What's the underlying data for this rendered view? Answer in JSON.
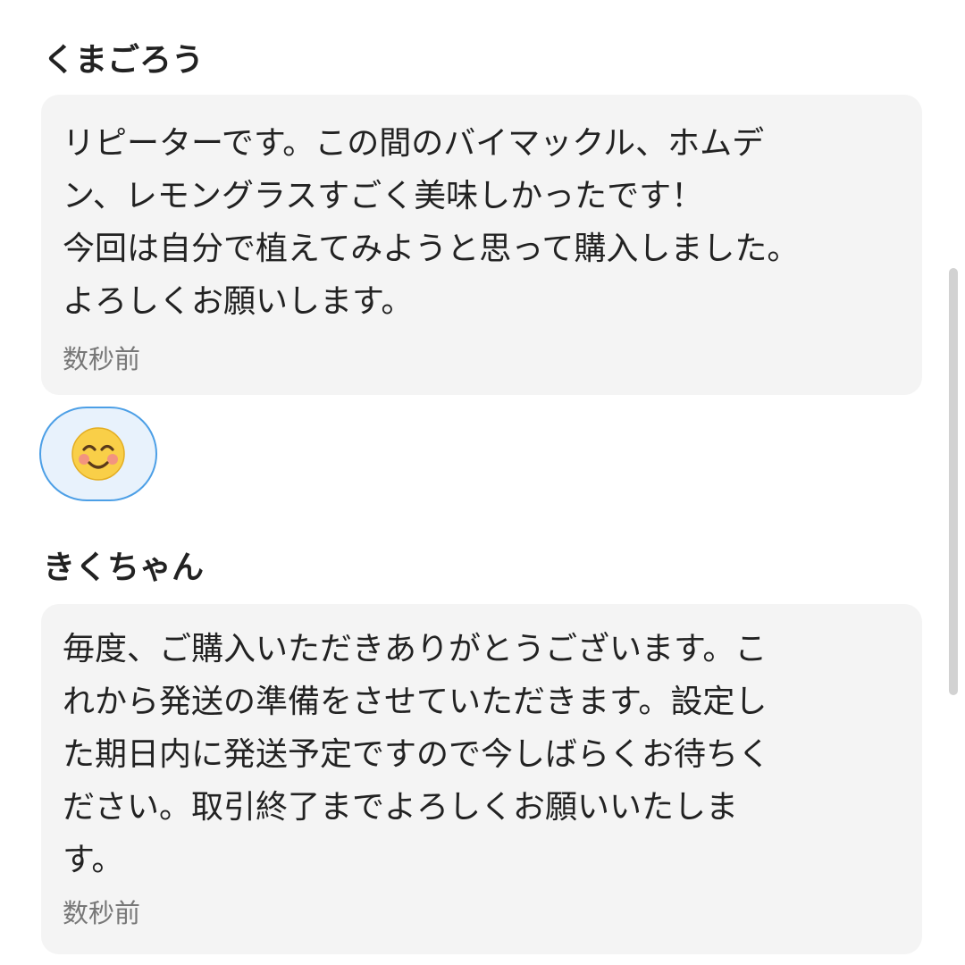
{
  "messages": [
    {
      "username": "くまごろう",
      "lines": [
        "リピーターです。この間のバイマックル、ホムデ",
        "ン、レモングラスすごく美味しかったです！",
        "今回は自分で植えてみようと思って購入しました。",
        "よろしくお願いします。"
      ],
      "timestamp": "数秒前",
      "reaction": {
        "icon": "smiling-face-icon"
      }
    },
    {
      "username": "きくちゃん",
      "lines": [
        "毎度、ご購入いただきありがとうございます。こ",
        "れから発送の準備をさせていただきます。設定し",
        "た期日内に発送予定ですので今しばらくお待ちく",
        "ださい。取引終了までよろしくお願いいたしま",
        "す。"
      ],
      "timestamp": "数秒前"
    }
  ],
  "colors": {
    "bubble_background": "#f4f4f4",
    "reaction_border": "#4c9fe6",
    "reaction_background": "#e8f2fc",
    "emoji_face": "#f9cf48",
    "emoji_blush": "#f28a8a",
    "timestamp_text": "#777777"
  }
}
